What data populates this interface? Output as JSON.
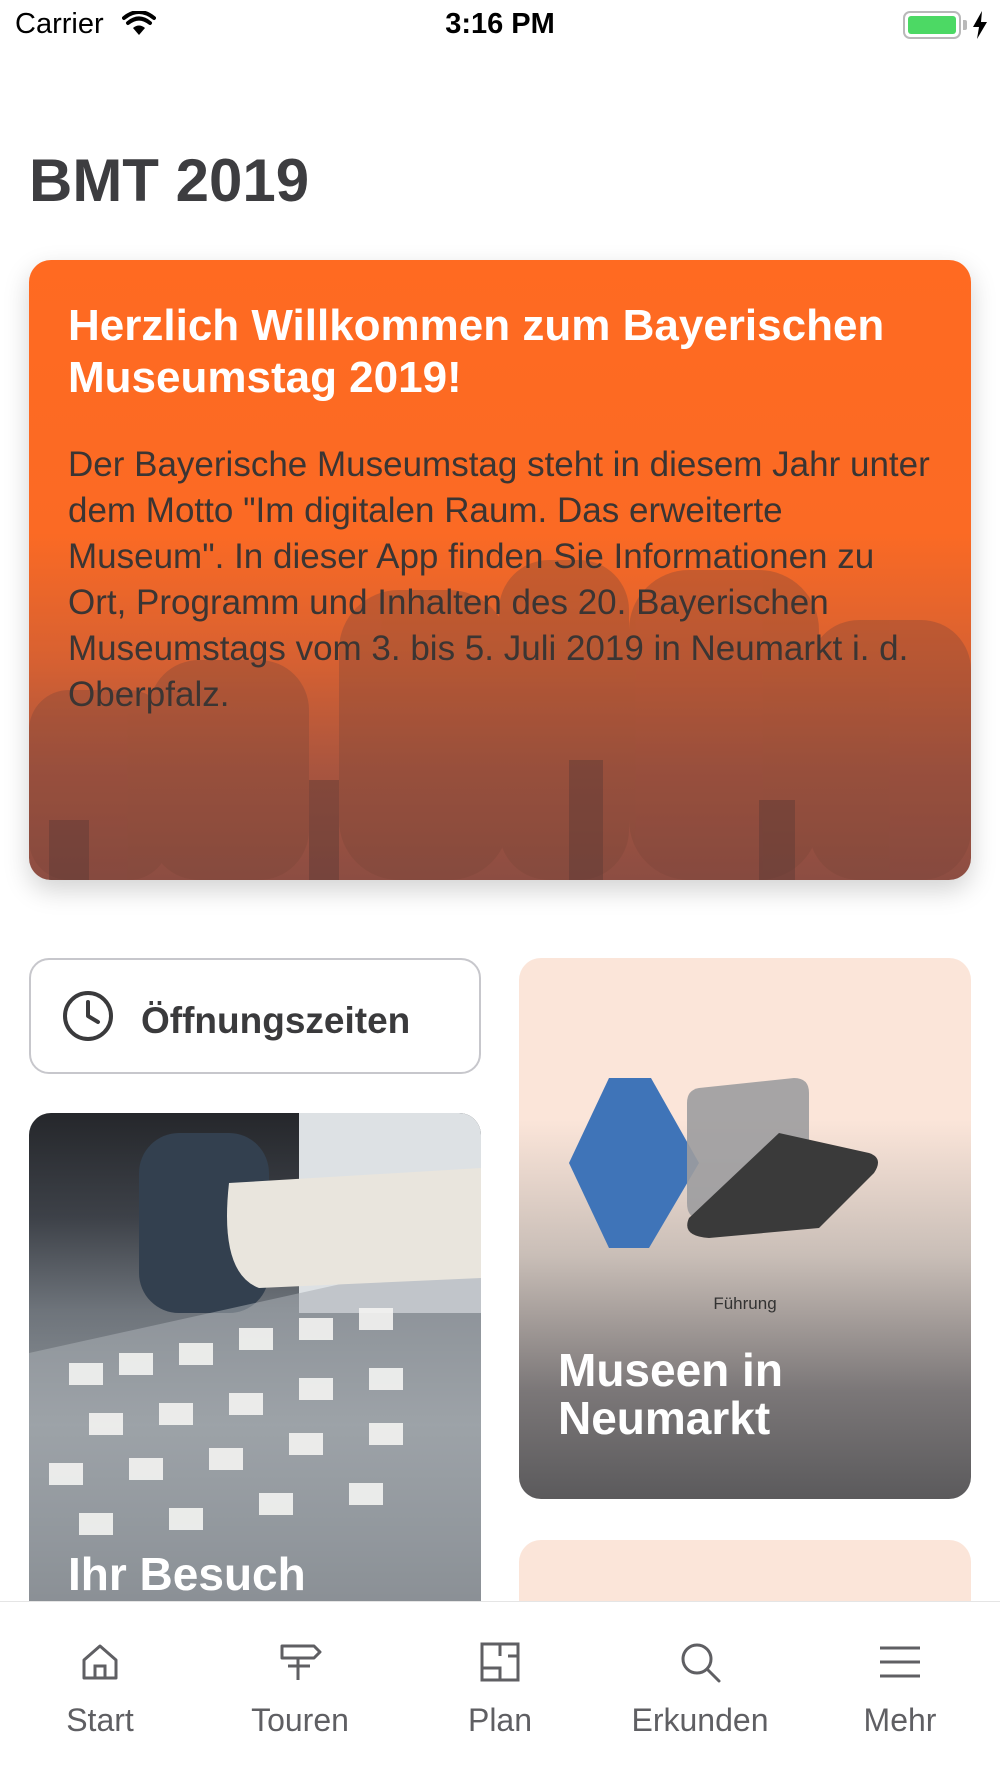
{
  "status_bar": {
    "carrier": "Carrier",
    "time": "3:16 PM",
    "battery_color": "#4cd964"
  },
  "page": {
    "title": "BMT 2019"
  },
  "welcome": {
    "heading": "Herzlich Willkommen zum Bayerischen Museumstag 2019!",
    "body": "Der Bayerische Museumstag steht in diesem Jahr unter dem Motto \"Im digitalen Raum. Das erweiterte Museum\". In dieser App finden Sie Informationen zu Ort, Programm und Inhalten des 20. Bayerischen Museumstags vom 3. bis 5. Juli 2019 in Neumarkt i. d. Oberpfalz.",
    "accent_color": "#ff6a21"
  },
  "tiles": {
    "hours": {
      "label": "Öffnungszeiten",
      "icon": "clock-icon"
    },
    "museen": {
      "caption": "Führung",
      "title": "Museen in Neumarkt"
    },
    "besuch": {
      "title": "Ihr Besuch"
    }
  },
  "tab_bar": {
    "tabs": [
      {
        "label": "Start",
        "icon": "home-icon"
      },
      {
        "label": "Touren",
        "icon": "signpost-icon"
      },
      {
        "label": "Plan",
        "icon": "map-icon"
      },
      {
        "label": "Erkunden",
        "icon": "search-icon"
      },
      {
        "label": "Mehr",
        "icon": "menu-icon"
      }
    ]
  }
}
